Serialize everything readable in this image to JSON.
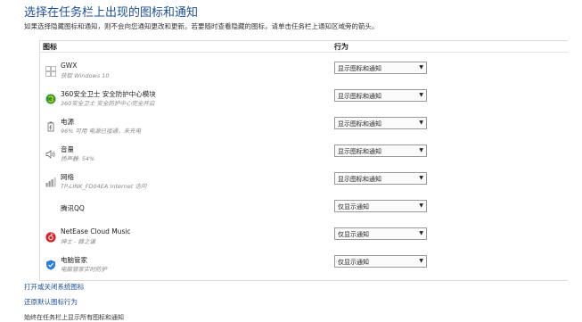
{
  "page": {
    "title": "选择在任务栏上出现的图标和通知",
    "description": "如果选择隐藏图标和通知，则不会向您通知更改和更新。若要随时查看隐藏的图标，请单击任务栏上通知区域旁的箭头。"
  },
  "table": {
    "col_icon": "图标",
    "col_behavior": "行为",
    "rows": [
      {
        "icon": "windows-icon",
        "name": "GWX",
        "sub": "获取 Windows 10",
        "behavior": "显示图标和通知"
      },
      {
        "icon": "360-security-icon",
        "name": "360安全卫士 安全防护中心模块",
        "sub": "360安全卫士 安全防护中心完全开启",
        "behavior": "显示图标和通知"
      },
      {
        "icon": "power-icon",
        "name": "电源",
        "sub": "96% 可用 电源已接通，未充电",
        "behavior": "显示图标和通知"
      },
      {
        "icon": "speaker-icon",
        "name": "音量",
        "sub": "扬声器: 54%",
        "behavior": "显示图标和通知"
      },
      {
        "icon": "network-icon",
        "name": "网络",
        "sub": "TP-LINK_FD04EA Internet 访问",
        "behavior": "显示图标和通知"
      },
      {
        "icon": "qq-icon",
        "name": "腾讯QQ",
        "sub": "",
        "behavior": "仅显示通知"
      },
      {
        "icon": "netease-music-icon",
        "name": "NetEase Cloud Music",
        "sub": "绅士 - 薛之谦",
        "behavior": "仅显示通知"
      },
      {
        "icon": "pc-manager-icon",
        "name": "电脑管家",
        "sub": "电脑管家实时防护",
        "behavior": "仅显示通知"
      }
    ]
  },
  "links": {
    "system_icons": "打开或关闭系统图标",
    "restore_default": "还原默认图标行为",
    "always_show": "始终在任务栏上显示所有图标和通知"
  },
  "colors": {
    "link": "#1e4f9b",
    "netease_red": "#d8232a",
    "shield_blue": "#2b7de0",
    "green_360": "#2a9d3a"
  }
}
